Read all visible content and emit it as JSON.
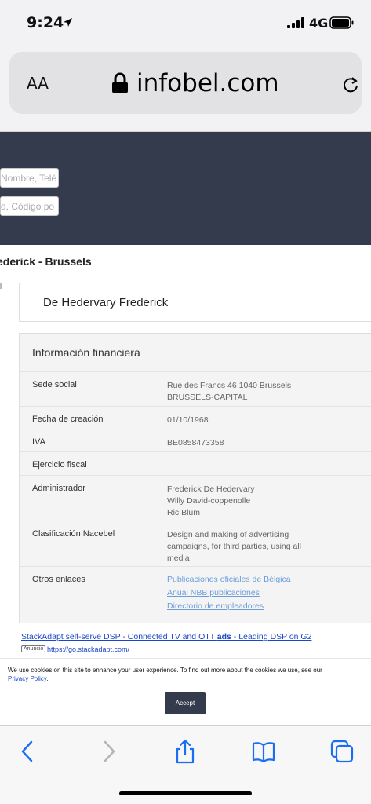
{
  "status": {
    "time": "9:24",
    "network": "4G"
  },
  "browser": {
    "aa_label": "AA",
    "url": "infobel.com"
  },
  "search": {
    "placeholder_one": "Nombre, Telé",
    "placeholder_two": "d, Código po"
  },
  "breadcrumb": "ederick - Brussels",
  "company": {
    "name": "De Hedervary Frederick"
  },
  "financial": {
    "title": "Información financiera",
    "rows": [
      {
        "label": "Sede social",
        "lines": [
          "Rue des Francs 46 1040 Brussels",
          "BRUSSELS-CAPITAL"
        ]
      },
      {
        "label": "Fecha de creación",
        "lines": [
          "01/10/1968"
        ]
      },
      {
        "label": "IVA",
        "lines": [
          "BE0858473358"
        ]
      },
      {
        "label": "Ejercicio fiscal",
        "lines": []
      },
      {
        "label": "Administrador",
        "lines": [
          "Frederick De Hedervary",
          "Willy David-coppenolle",
          "Ric Blum"
        ]
      },
      {
        "label": "Clasificación Nacebel",
        "lines": [
          "Design and making of advertising",
          "campaigns, for third parties, using all",
          "media"
        ]
      },
      {
        "label": "Otros enlaces",
        "links": [
          "Publicaciones oficiales de Bélgica",
          "Anual NBB publicaciones",
          "Directorio de empleadores"
        ]
      }
    ]
  },
  "ad": {
    "headline_part1": "StackAdapt self-serve DSP - Connected TV and OTT ",
    "headline_bold": "ads",
    "headline_part2": " - Leading DSP on G2",
    "badge": "Anuncio",
    "url": "https://go.stackadapt.com/"
  },
  "cookie": {
    "text": "We use cookies on this site to enhance your user experience. To find out more about the cookies we use, see our",
    "link": "Privacy Policy",
    "accept_label": "Accept"
  },
  "colors": {
    "header_bg": "#343b4d",
    "link_blue": "#6b9ddb",
    "ios_blue": "#1a6ef5"
  }
}
